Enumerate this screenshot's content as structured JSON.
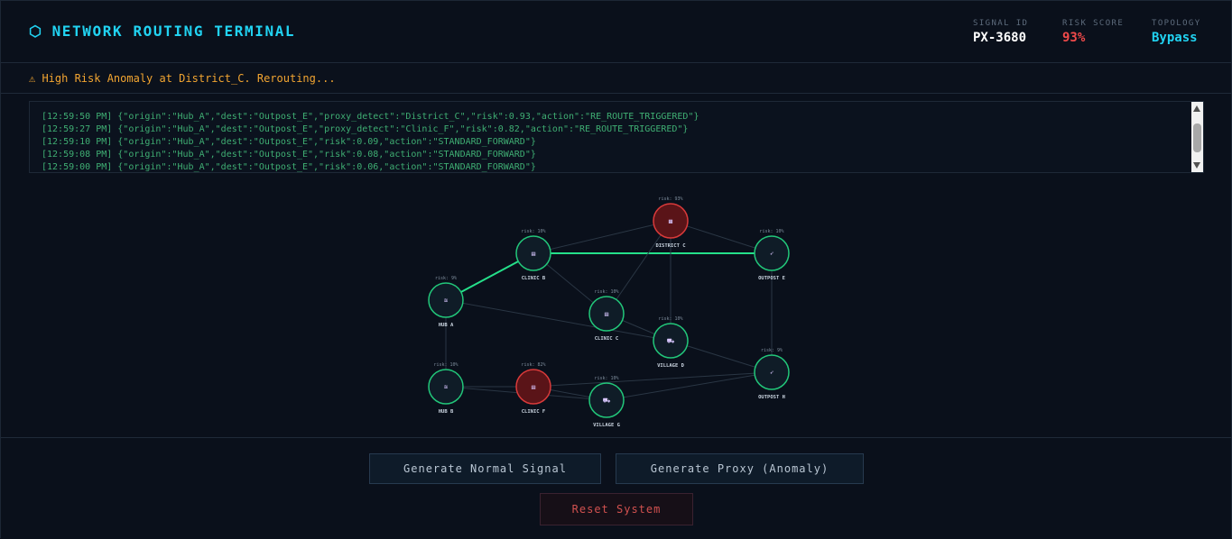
{
  "header": {
    "title": "NETWORK ROUTING TERMINAL",
    "stats": [
      {
        "label": "SIGNAL ID",
        "value": "PX-3680",
        "color": "#ffffff"
      },
      {
        "label": "RISK SCORE",
        "value": "93%",
        "color": "#f04a4a"
      },
      {
        "label": "TOPOLOGY",
        "value": "Bypass",
        "color": "#21d3f2"
      }
    ]
  },
  "alert": {
    "text": "⚠ High Risk Anomaly at District_C. Rerouting..."
  },
  "log": {
    "lines": [
      "[12:59:50 PM] {\"origin\":\"Hub_A\",\"dest\":\"Outpost_E\",\"proxy_detect\":\"District_C\",\"risk\":0.93,\"action\":\"RE_ROUTE_TRIGGERED\"}",
      "[12:59:27 PM] {\"origin\":\"Hub_A\",\"dest\":\"Outpost_E\",\"proxy_detect\":\"Clinic_F\",\"risk\":0.82,\"action\":\"RE_ROUTE_TRIGGERED\"}",
      "[12:59:10 PM] {\"origin\":\"Hub_A\",\"dest\":\"Outpost_E\",\"risk\":0.09,\"action\":\"STANDARD_FORWARD\"}",
      "[12:59:08 PM] {\"origin\":\"Hub_A\",\"dest\":\"Outpost_E\",\"risk\":0.08,\"action\":\"STANDARD_FORWARD\"}",
      "[12:59:00 PM] {\"origin\":\"Hub_A\",\"dest\":\"Outpost_E\",\"risk\":0.06,\"action\":\"STANDARD_FORWARD\"}"
    ]
  },
  "graph": {
    "colors": {
      "safe": "#22c77a",
      "danger": "#d93a3a",
      "edge": "#2a3644",
      "active": "#25e08a"
    },
    "nodes": [
      {
        "id": "hub_a",
        "label": "HUB A",
        "risk": "risk: 9%",
        "icon": "≋",
        "status": "safe"
      },
      {
        "id": "clinic_b",
        "label": "CLINIC B",
        "risk": "risk: 10%",
        "icon": "▤",
        "status": "safe"
      },
      {
        "id": "district_c",
        "label": "DISTRICT C",
        "risk": "risk: 93%",
        "icon": "▦",
        "status": "danger"
      },
      {
        "id": "outpost_e",
        "label": "OUTPOST E",
        "risk": "risk: 10%",
        "icon": "➶",
        "status": "safe"
      },
      {
        "id": "clinic_c",
        "label": "CLINIC C",
        "risk": "risk: 10%",
        "icon": "▤",
        "status": "safe"
      },
      {
        "id": "village_d",
        "label": "VILLAGE D",
        "risk": "risk: 10%",
        "icon": "⛟",
        "status": "safe"
      },
      {
        "id": "hub_b",
        "label": "HUB B",
        "risk": "risk: 10%",
        "icon": "≋",
        "status": "safe"
      },
      {
        "id": "clinic_f",
        "label": "CLINIC F",
        "risk": "risk: 82%",
        "icon": "▤",
        "status": "danger"
      },
      {
        "id": "village_g",
        "label": "VILLAGE G",
        "risk": "risk: 10%",
        "icon": "⛟",
        "status": "safe"
      },
      {
        "id": "outpost_h",
        "label": "OUTPOST H",
        "risk": "risk: 9%",
        "icon": "➶",
        "status": "safe"
      }
    ],
    "edges": [
      {
        "from": "hub_a",
        "to": "clinic_b",
        "active": true
      },
      {
        "from": "clinic_b",
        "to": "outpost_e",
        "active": true
      },
      {
        "from": "clinic_b",
        "to": "district_c",
        "active": false
      },
      {
        "from": "district_c",
        "to": "outpost_e",
        "active": false
      },
      {
        "from": "district_c",
        "to": "clinic_c",
        "active": false
      },
      {
        "from": "district_c",
        "to": "village_d",
        "active": false
      },
      {
        "from": "clinic_b",
        "to": "clinic_c",
        "active": false
      },
      {
        "from": "clinic_c",
        "to": "village_d",
        "active": false
      },
      {
        "from": "hub_a",
        "to": "village_d",
        "active": false
      },
      {
        "from": "hub_a",
        "to": "hub_b",
        "active": false
      },
      {
        "from": "outpost_e",
        "to": "outpost_h",
        "active": false
      },
      {
        "from": "village_d",
        "to": "outpost_h",
        "active": false
      },
      {
        "from": "hub_b",
        "to": "clinic_f",
        "active": false
      },
      {
        "from": "hub_b",
        "to": "village_g",
        "active": false
      },
      {
        "from": "clinic_f",
        "to": "village_g",
        "active": false
      },
      {
        "from": "clinic_f",
        "to": "outpost_h",
        "active": false
      },
      {
        "from": "village_g",
        "to": "outpost_h",
        "active": false
      }
    ]
  },
  "actions": {
    "normal": "Generate Normal Signal",
    "proxy": "Generate Proxy (Anomaly)",
    "reset": "Reset System"
  }
}
